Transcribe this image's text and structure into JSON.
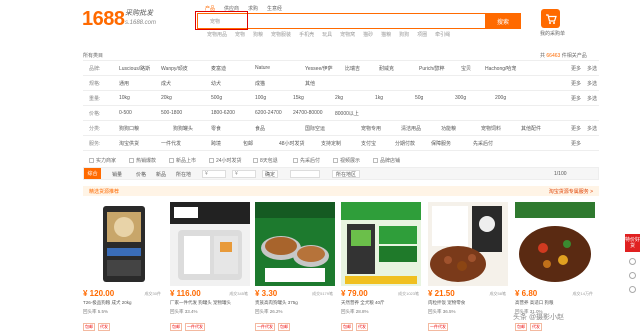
{
  "header": {
    "logo": "1688",
    "slogan": "采购批发",
    "slogan_sub": "s.1688.com",
    "search_tabs": [
      "产品",
      "供应商",
      "求购",
      "生意经"
    ],
    "search_placeholder": "宠物",
    "search_button": "搜索",
    "hot_words": [
      "宠物用品",
      "宠物",
      "狗粮",
      "宠物服装",
      "手机壳",
      "玩具",
      "宠物窝",
      "猫砂",
      "猫粮",
      "狗狗",
      "项圈",
      "牵引绳"
    ],
    "cart_icon": "cart-icon",
    "cart_label": "我的采购单"
  },
  "filters": {
    "all_categories": "所有类目",
    "result_count_prefix": "共",
    "result_count": "66463",
    "result_count_suffix": "件相关产品",
    "more_label": "更多",
    "multi_label": "多选",
    "rows": [
      {
        "label": "品牌:",
        "values": [
          "Luscious/路斯",
          "Wanpy/顽皮",
          "麦富迪",
          "Nature",
          "Yessee/伊萨",
          "比瑞吉",
          "耐威克",
          "Purich/醇粹",
          "宝贝",
          "Hachong/哈宠"
        ]
      },
      {
        "label": "规格:",
        "values": [
          "通用",
          "成犬",
          "幼犬",
          "成猫",
          "其他"
        ]
      },
      {
        "label": "重量:",
        "values": [
          "10kg",
          "20kg",
          "500g",
          "100g",
          "15kg",
          "2kg",
          "1kg",
          "50g",
          "300g",
          "200g"
        ]
      },
      {
        "label": "价格:",
        "values": [
          "0-500",
          "500-1800",
          "1800-6200",
          "6200-24700",
          "24700-80000",
          "80000以上"
        ]
      },
      {
        "label": "分类:",
        "values": [
          "狗狗口粮",
          "狗狗罐头",
          "零食",
          "食品",
          "国际空运",
          "宠物专用",
          "清洁用品",
          "功能粮",
          "宠物饲料",
          "其他配件"
        ]
      },
      {
        "label": "服务:",
        "values": [
          "淘宝供货",
          "一件代发",
          "跨境",
          "包邮",
          "48小时发货",
          "支持定制",
          "支付宝",
          "分期付款",
          "保障服务",
          "先采后付"
        ]
      }
    ]
  },
  "checkboxes": [
    "实力商家",
    "热销爆款",
    "新品上市",
    "24小时发货",
    "8天包退",
    "先采后付",
    "视频展示",
    "品牌店铺"
  ],
  "sortbar": {
    "items": [
      "综合",
      "销量",
      "价格",
      "新品",
      "所在地"
    ],
    "price_from": "¥",
    "price_to": "¥",
    "confirm": "确定",
    "location_label": "所在地区",
    "pager": "1/100"
  },
  "promo": {
    "left": "精选货源推荐",
    "right": "淘宝货源专属服务 >"
  },
  "products": [
    {
      "price": "¥ 120.00",
      "sold": "成交30件",
      "title": "T26-极品狗粮 成犬 20kg",
      "meta": "回头率 5.5%",
      "tags": [
        "包邮",
        "代发"
      ],
      "img": "product-dog-food-bag"
    },
    {
      "price": "¥ 116.00",
      "sold": "成交345笔",
      "title": "厂家一件代发 狗罐头 宠物罐头",
      "meta": "回头率 33.4%",
      "tags": [
        "包邮",
        "一件代发"
      ],
      "img": "product-dog-can"
    },
    {
      "price": "¥ 3.30",
      "sold": "成交5179笔",
      "title": "贵族高肉狗罐头 375g",
      "meta": "回头率 26.2%",
      "tags": [
        "一件代发",
        "包邮"
      ],
      "img": "product-meat-can"
    },
    {
      "price": "¥ 79.00",
      "sold": "成交1023笔",
      "title": "天然营养 全犬粮 40斤",
      "meta": "回头率 28.8%",
      "tags": [
        "包邮",
        "代发"
      ],
      "img": "product-natural-food"
    },
    {
      "price": "¥ 21.50",
      "sold": "成交58笔",
      "title": "肉粒拌饭 宠物零食",
      "meta": "回头率 36.5%",
      "tags": [
        "一件代发"
      ],
      "img": "product-meat-topping"
    },
    {
      "price": "¥ 6.80",
      "sold": "成交14万件",
      "title": "高营养 高适口 狗粮",
      "meta": "回头率 31.0%",
      "tags": [
        "包邮",
        "代发"
      ],
      "img": "product-high-nutrition"
    }
  ],
  "sidebar": {
    "promo": "特价好货"
  },
  "watermark": "头条 @摄影小赵"
}
